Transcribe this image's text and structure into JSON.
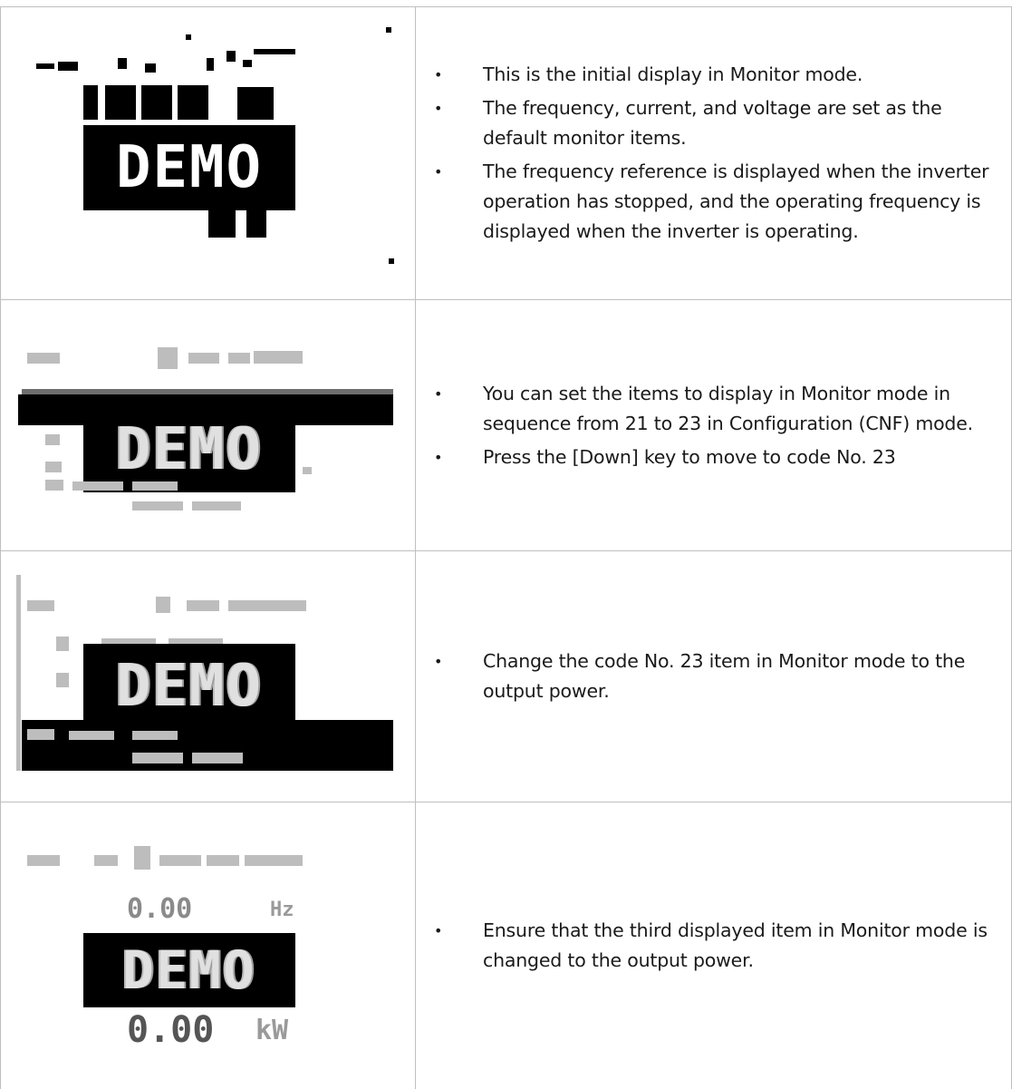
{
  "rows": [
    {
      "bullets": [
        "This is the initial display in Monitor mode.",
        "The frequency, current, and voltage are set as the default monitor items.",
        "The frequency reference is displayed when the inverter operation has stopped, and the operating frequency is displayed when the inverter is operating."
      ],
      "screen": {
        "demo": "DEMO"
      }
    },
    {
      "bullets": [
        "You can set the items to display in Monitor mode in sequence from 21 to 23 in Configuration (CNF) mode.",
        "Press the [Down] key to move to code No. 23"
      ],
      "screen": {
        "demo": "DEMO"
      }
    },
    {
      "bullets": [
        "Change the code No. 23 item in Monitor mode to the output power."
      ],
      "screen": {
        "demo": "DEMO"
      }
    },
    {
      "bullets": [
        "Ensure that the third displayed item in Monitor mode is changed to the output power."
      ],
      "screen": {
        "demo": "DEMO",
        "top_value": "0.00",
        "top_unit": "Hz",
        "bottom_value": "0.00",
        "bottom_unit": "kW"
      }
    }
  ]
}
